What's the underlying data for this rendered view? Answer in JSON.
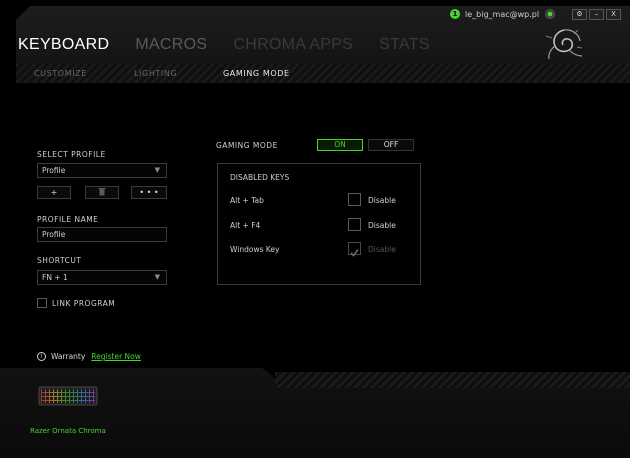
{
  "user": {
    "avatar_letter": "1",
    "email": "le_big_mac@wp.pl"
  },
  "window_buttons": [
    "⚙",
    "–",
    "X"
  ],
  "nav": {
    "tabs": [
      {
        "label": "KEYBOARD"
      },
      {
        "label": "MACROS"
      },
      {
        "label": "CHROMA APPS"
      },
      {
        "label": "STATS"
      }
    ],
    "subtabs": [
      {
        "label": "CUSTOMIZE"
      },
      {
        "label": "LIGHTING"
      },
      {
        "label": "GAMING MODE"
      }
    ]
  },
  "profile": {
    "select_label": "SELECT PROFILE",
    "selected": "Profile",
    "add_btn": "+",
    "more_btn": "• • •",
    "name_label": "PROFILE NAME",
    "name_value": "Profile",
    "shortcut_label": "SHORTCUT",
    "shortcut_value": "FN + 1",
    "link_program_label": "LINK PROGRAM"
  },
  "gaming_mode": {
    "label": "GAMING MODE",
    "on_label": "ON",
    "off_label": "OFF",
    "state": "on"
  },
  "disabled_keys": {
    "title": "DISABLED KEYS",
    "rows": [
      {
        "key": "Alt + Tab",
        "option": "Disable",
        "checked": false,
        "enabled": true
      },
      {
        "key": "Alt + F4",
        "option": "Disable",
        "checked": false,
        "enabled": true
      },
      {
        "key": "Windows Key",
        "option": "Disable",
        "checked": true,
        "enabled": false
      }
    ]
  },
  "warranty": {
    "label": "Warranty",
    "link": "Register Now"
  },
  "device": {
    "name": "Razer Ornata Chroma"
  },
  "colors": {
    "accent": "#44d62c",
    "background": "#000000"
  }
}
